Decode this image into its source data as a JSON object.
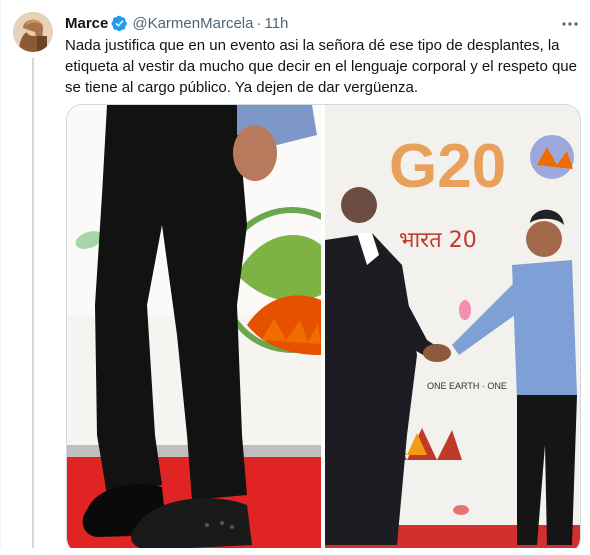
{
  "tweet": {
    "author_name": "Marce",
    "author_handle": "@KarmenMarcela",
    "separator": "·",
    "timestamp": "11h",
    "text": "Nada justifica que en un evento asi la señora dé ese tipo de desplantes, la etiqueta al vestir da mucho que decir en el lenguaje corporal y el respeto que se tiene al cargo público. Ya dejen de dar vergüenza.",
    "verified": true
  },
  "media": {
    "left_photo": {},
    "right_photo": {
      "backdrop_logo": "G20",
      "backdrop_hindi": "भारत 20",
      "backdrop_slogan": "ONE EARTH · ONE"
    }
  },
  "colors": {
    "text_primary": "#0f1419",
    "text_secondary": "#536471",
    "verified_blue": "#1d9bf0",
    "border": "#cfd9de"
  }
}
